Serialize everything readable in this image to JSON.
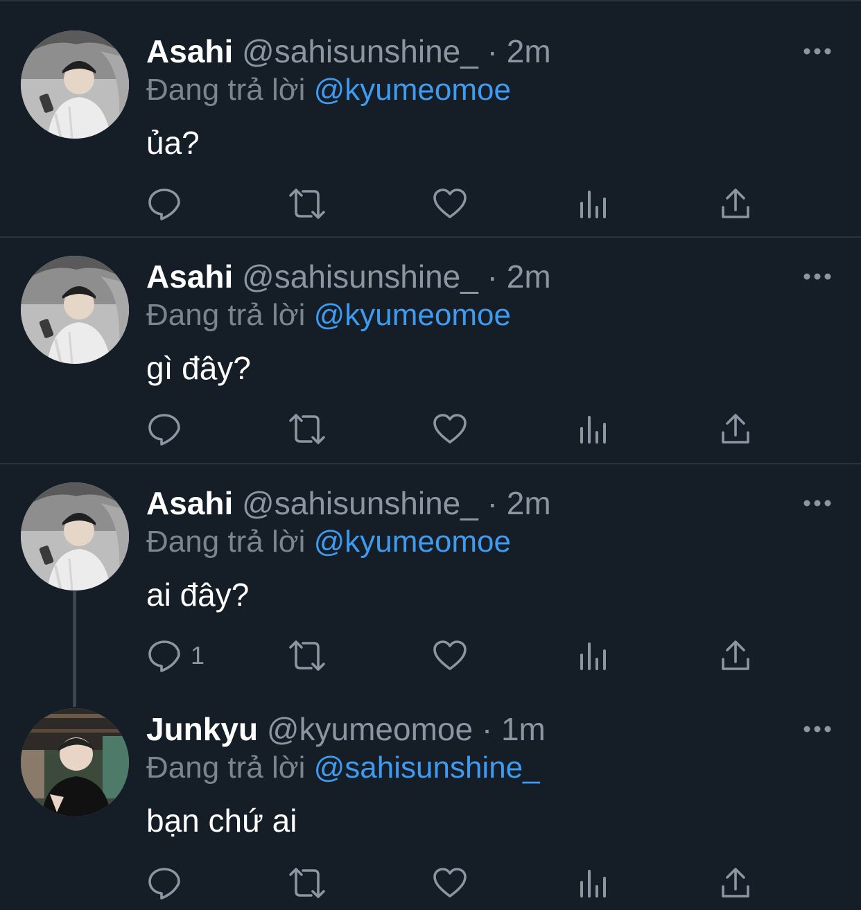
{
  "tweets": [
    {
      "name": "Asahi",
      "handle": "@sahisunshine_",
      "dot": "·",
      "time": "2m",
      "reply_prefix": "Đang trả lời",
      "reply_mention": "@kyumeomoe",
      "text": "ủa?",
      "reply_count": ""
    },
    {
      "name": "Asahi",
      "handle": "@sahisunshine_",
      "dot": "·",
      "time": "2m",
      "reply_prefix": "Đang trả lời",
      "reply_mention": "@kyumeomoe",
      "text": "gì đây?",
      "reply_count": ""
    },
    {
      "name": "Asahi",
      "handle": "@sahisunshine_",
      "dot": "·",
      "time": "2m",
      "reply_prefix": "Đang trả lời",
      "reply_mention": "@kyumeomoe",
      "text": "ai đây?",
      "reply_count": "1"
    },
    {
      "name": "Junkyu",
      "handle": "@kyumeomoe",
      "dot": "·",
      "time": "1m",
      "reply_prefix": "Đang trả lời",
      "reply_mention": "@sahisunshine_",
      "text": "bạn chứ ai",
      "reply_count": ""
    }
  ],
  "icons": {
    "more": "more-horizontal-icon",
    "reply": "reply-bubble-icon",
    "retweet": "retweet-icon",
    "like": "heart-icon",
    "views": "views-bar-chart-icon",
    "share": "share-upload-icon"
  },
  "colors": {
    "background": "#151d27",
    "divider": "#2a3440",
    "name": "#ffffff",
    "secondary_text": "#8a96a2",
    "mention": "#3f9bf0",
    "icon": "#8a96a2"
  }
}
